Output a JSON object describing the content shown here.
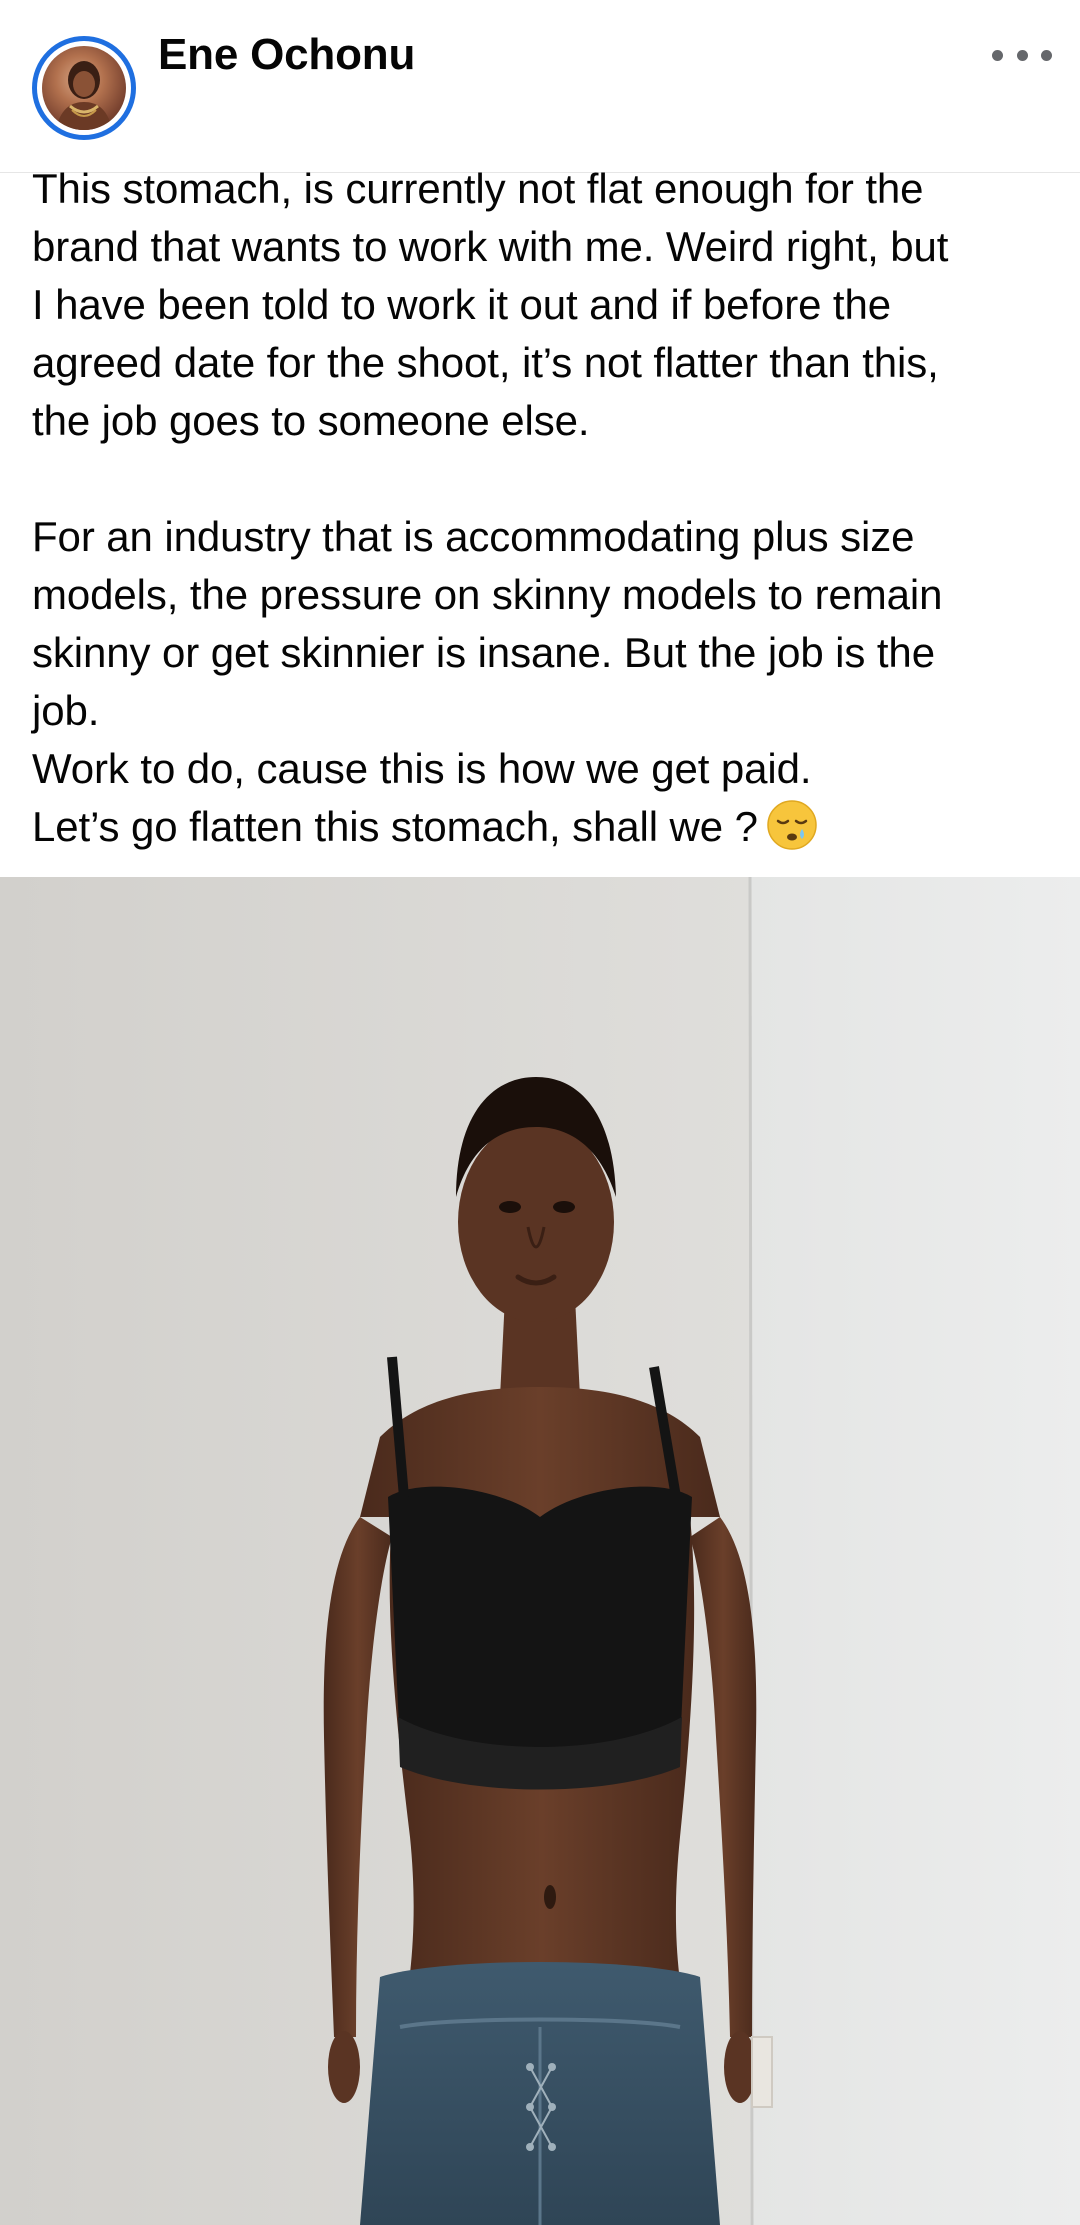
{
  "post": {
    "author_name": "Ene Ochonu",
    "more_icon": "more-horizontal-icon",
    "paragraph_1": [
      "This stomach, is currently not flat enough for the",
      "brand that wants to work with me. Weird right, but",
      "I have been told to work it out and if before the",
      "agreed date for the shoot, it’s not flatter than this,",
      "the job goes to someone else."
    ],
    "paragraph_2": [
      "For an industry that is accommodating plus size",
      "models, the pressure on skinny models to remain",
      "skinny or get skinnier is insane. But the job is the",
      "job.",
      "Work to do, cause this is how we get paid."
    ],
    "last_line": "Let’s go flatten this stomach, shall we ?",
    "emoji_icon": "sleepy-face-emoji",
    "photo_icon": "post-photo"
  },
  "colors": {
    "avatar_ring": "#1f6fe0",
    "text": "#050505",
    "icon_gray": "#65676b",
    "wall": "#dcdcdc"
  }
}
